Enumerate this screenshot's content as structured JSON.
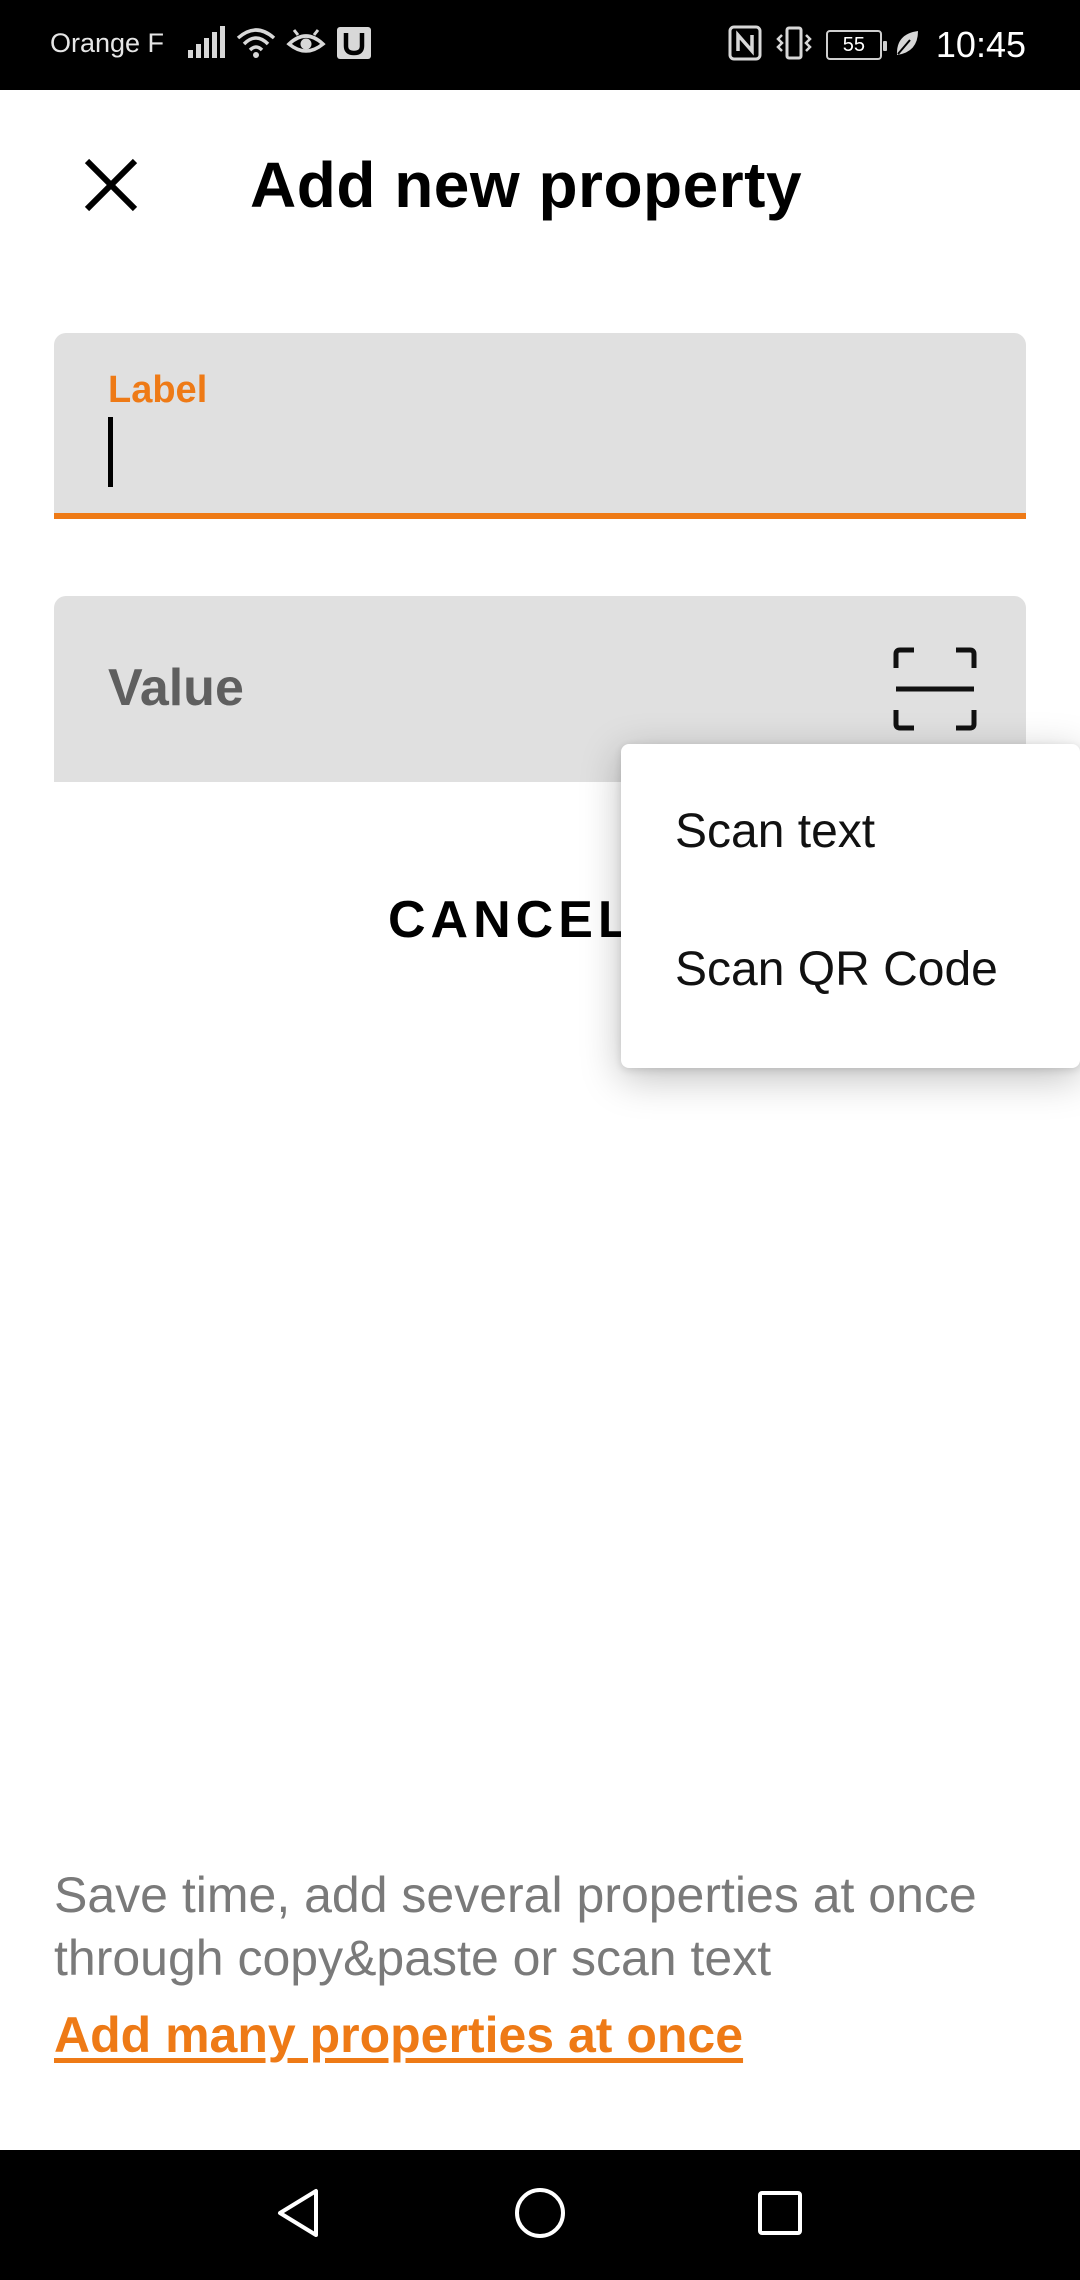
{
  "status_bar": {
    "carrier": "Orange F",
    "battery": "55",
    "time": "10:45",
    "icons": [
      "signal-icon",
      "wifi-icon",
      "eye-icon",
      "u-app-icon",
      "nfc-icon",
      "vibrate-icon",
      "battery-icon",
      "leaf-icon"
    ]
  },
  "header": {
    "title": "Add new property",
    "close_icon": "close-icon"
  },
  "form": {
    "label_field": {
      "caption": "Label",
      "value": ""
    },
    "value_field": {
      "placeholder": "Value",
      "scan_icon": "scan-frame-icon"
    },
    "cancel_label": "CANCEL"
  },
  "popup_menu": {
    "items": [
      {
        "label": "Scan text"
      },
      {
        "label": "Scan QR Code"
      }
    ]
  },
  "footer": {
    "info_text": "Save time, add several properties at once through copy&paste or scan text",
    "link_label": "Add many properties at once"
  },
  "colors": {
    "accent": "#ee7a16",
    "field_background": "#e0e0e0",
    "info_text": "#7a7a7a"
  },
  "nav_bar": {
    "icons": [
      "back-triangle-icon",
      "home-circle-icon",
      "recents-square-icon"
    ]
  }
}
